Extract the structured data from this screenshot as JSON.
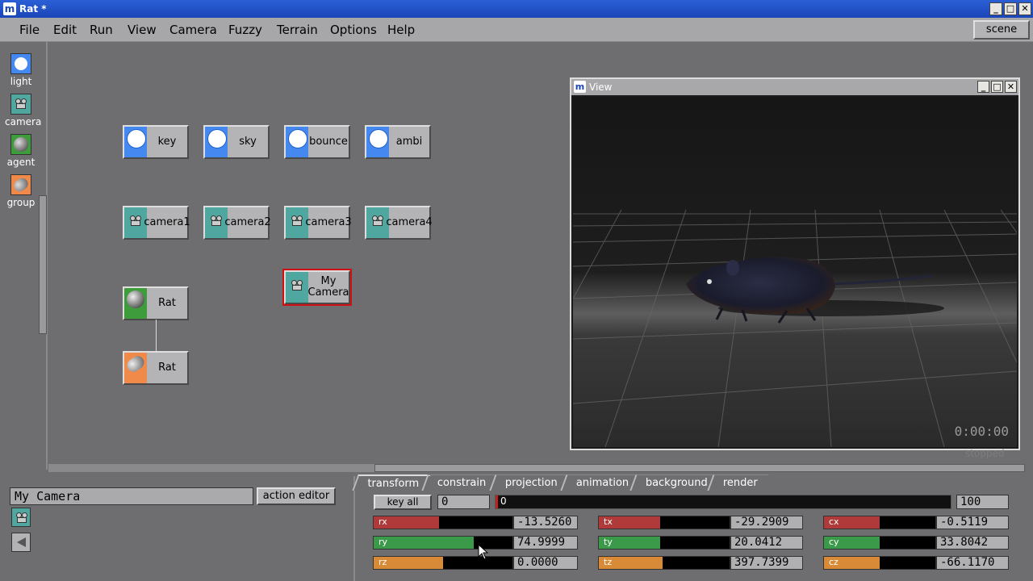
{
  "window": {
    "logo": "m",
    "title": "Rat *",
    "controls": [
      "_",
      "□",
      "✕"
    ]
  },
  "menubar": {
    "items": [
      "File",
      "Edit",
      "Run",
      "View",
      "Camera",
      "Fuzzy",
      "Terrain",
      "Options",
      "Help"
    ],
    "scene_button": "scene"
  },
  "palette": {
    "items": [
      {
        "label": "light",
        "icon": "light-bulb-icon"
      },
      {
        "label": "camera",
        "icon": "camera-icon"
      },
      {
        "label": "agent",
        "icon": "agent-sphere-icon"
      },
      {
        "label": "group",
        "icon": "group-icon"
      }
    ]
  },
  "nodes": {
    "lights": [
      "key",
      "sky",
      "bounce",
      "ambi"
    ],
    "cameras": [
      "camera1",
      "camera2",
      "camera3",
      "camera4"
    ],
    "selected_camera": "My Camera",
    "agent": "Rat",
    "group": "Rat"
  },
  "view": {
    "title": "View",
    "timecode": "0:00:00",
    "status": "stopped"
  },
  "bottom": {
    "object_name": "My Camera",
    "action_editor": "action editor",
    "tabs": [
      "transform",
      "constrain",
      "projection",
      "animation",
      "background",
      "render"
    ],
    "active_tab": "transform",
    "key_all": "key all",
    "frame": "0",
    "timeline_marker": "0",
    "end_frame": "100",
    "rotation": [
      {
        "label": "rx",
        "value": "-13.5260",
        "color": "#b03a3a",
        "fill": 0.47
      },
      {
        "label": "ry",
        "value": "74.9999",
        "color": "#3a9a4a",
        "fill": 0.72
      },
      {
        "label": "rz",
        "value": "0.0000",
        "color": "#d88a36",
        "fill": 0.5
      }
    ],
    "translation": [
      {
        "label": "tx",
        "value": "-29.2909",
        "color": "#b03a3a",
        "fill": 0.47
      },
      {
        "label": "ty",
        "value": "20.0412",
        "color": "#3a9a4a",
        "fill": 0.47
      },
      {
        "label": "tz",
        "value": "397.7399",
        "color": "#d88a36",
        "fill": 0.49
      }
    ],
    "center": [
      {
        "label": "cx",
        "value": "-0.5119",
        "color": "#b03a3a",
        "fill": 0.5
      },
      {
        "label": "cy",
        "value": "33.8042",
        "color": "#3a9a4a",
        "fill": 0.5
      },
      {
        "label": "cz",
        "value": "-66.1170",
        "color": "#d88a36",
        "fill": 0.5
      }
    ]
  }
}
